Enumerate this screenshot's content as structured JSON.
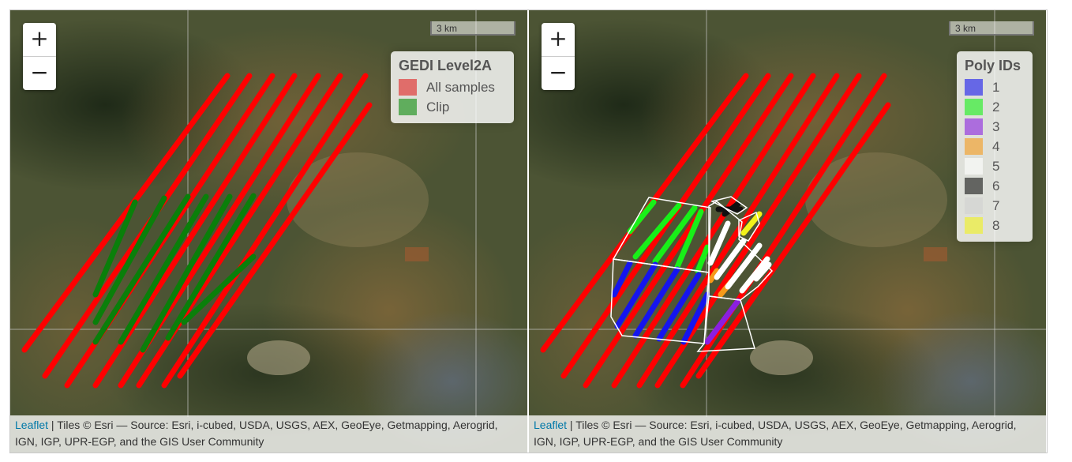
{
  "maps": [
    {
      "legend": {
        "title": "GEDI Level2A",
        "items": [
          {
            "label": "All samples",
            "color": "#e02020"
          },
          {
            "label": "Clip",
            "color": "#0a8a0a"
          }
        ]
      }
    },
    {
      "legend": {
        "title": "Poly IDs",
        "items": [
          {
            "label": "1",
            "color": "#1515ee"
          },
          {
            "label": "2",
            "color": "#18f018"
          },
          {
            "label": "3",
            "color": "#8b1fe0"
          },
          {
            "label": "4",
            "color": "#f59a1a"
          },
          {
            "label": "5",
            "color": "#ffffff"
          },
          {
            "label": "6",
            "color": "#101010"
          },
          {
            "label": "7",
            "color": "#d0d0d0"
          },
          {
            "label": "8",
            "color": "#f2f21a"
          }
        ]
      }
    }
  ],
  "controls": {
    "zoom_in": "+",
    "zoom_out": "−"
  },
  "scale": {
    "label": "3 km"
  },
  "attribution": {
    "leaflet": "Leaflet",
    "text": " | Tiles © Esri — Source: Esri, i-cubed, USDA, USGS, AEX, GeoEye, Getmapping, Aerogrid, IGN, IGP, UPR-EGP, and the GIS User Community"
  },
  "colors": {
    "track": "#ff0000",
    "clip": "#0a7f0a",
    "poly_outline": "#ffffff"
  }
}
